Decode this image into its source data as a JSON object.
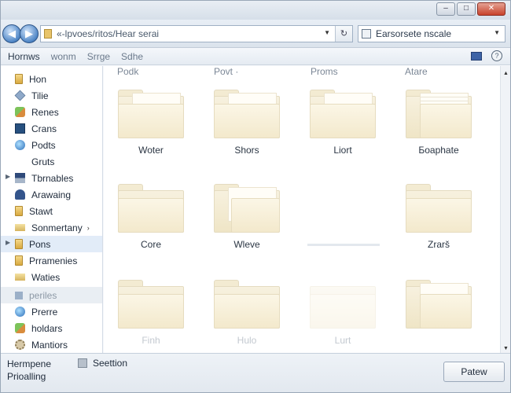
{
  "window_controls": {
    "minimize": "–",
    "maximize": "□",
    "close": "✕"
  },
  "nav": {
    "back_glyph": "◀",
    "forward_glyph": "▶"
  },
  "address": {
    "path": "«-lpvoes/ritos/Hear serai",
    "refresh_glyph": "↻"
  },
  "search": {
    "value": "Earsorsete nscale"
  },
  "toolbar": {
    "items": [
      "Hornws",
      "wonm",
      "Srrge",
      "Sdhe"
    ],
    "help_glyph": "?"
  },
  "sidebar": {
    "items": [
      {
        "label": "Hon",
        "icon": "folder-icon"
      },
      {
        "label": "Tilie",
        "icon": "diamond-icon"
      },
      {
        "label": "Renes",
        "icon": "leaf-icon"
      },
      {
        "label": "Crans",
        "icon": "monitor-icon"
      },
      {
        "label": "Podts",
        "icon": "globe-icon"
      },
      {
        "label": "Gruts",
        "icon": ""
      },
      {
        "label": "Tbrnables",
        "icon": "strip-icon"
      },
      {
        "label": "Arawaing",
        "icon": "person-icon"
      },
      {
        "label": "Stawt",
        "icon": "folder-icon"
      },
      {
        "label": "Sonmertany",
        "icon": "flat-folder-icon"
      },
      {
        "label": "Pons",
        "icon": "folder-icon"
      },
      {
        "label": "Prramenies",
        "icon": "folder-icon"
      },
      {
        "label": "Waties",
        "icon": "flat-folder-icon"
      },
      {
        "label": "periles",
        "icon": "small-icon"
      },
      {
        "label": "Prerre",
        "icon": "globe-icon"
      },
      {
        "label": "holdars",
        "icon": "leaf-icon"
      },
      {
        "label": "Mantiors",
        "icon": "gear-icon"
      }
    ],
    "arrow_glyph": "›",
    "expand_glyph": "▶"
  },
  "columns": [
    "Podk",
    "Povt ·",
    "Proms",
    "Atare"
  ],
  "folders": [
    {
      "label": "Woter"
    },
    {
      "label": "Shors"
    },
    {
      "label": "Liort"
    },
    {
      "label": "Боaphate"
    },
    {
      "label": "Core"
    },
    {
      "label": "Wleve"
    },
    {
      "label": ""
    },
    {
      "label": "Zrarš"
    },
    {
      "label": "Finh"
    },
    {
      "label": "Hulo"
    },
    {
      "label": "Lurt"
    },
    {
      "label": ""
    }
  ],
  "details": {
    "line1": "Hermpene",
    "line2": "Prioalling",
    "section": "Seettion",
    "button": "Patew"
  }
}
